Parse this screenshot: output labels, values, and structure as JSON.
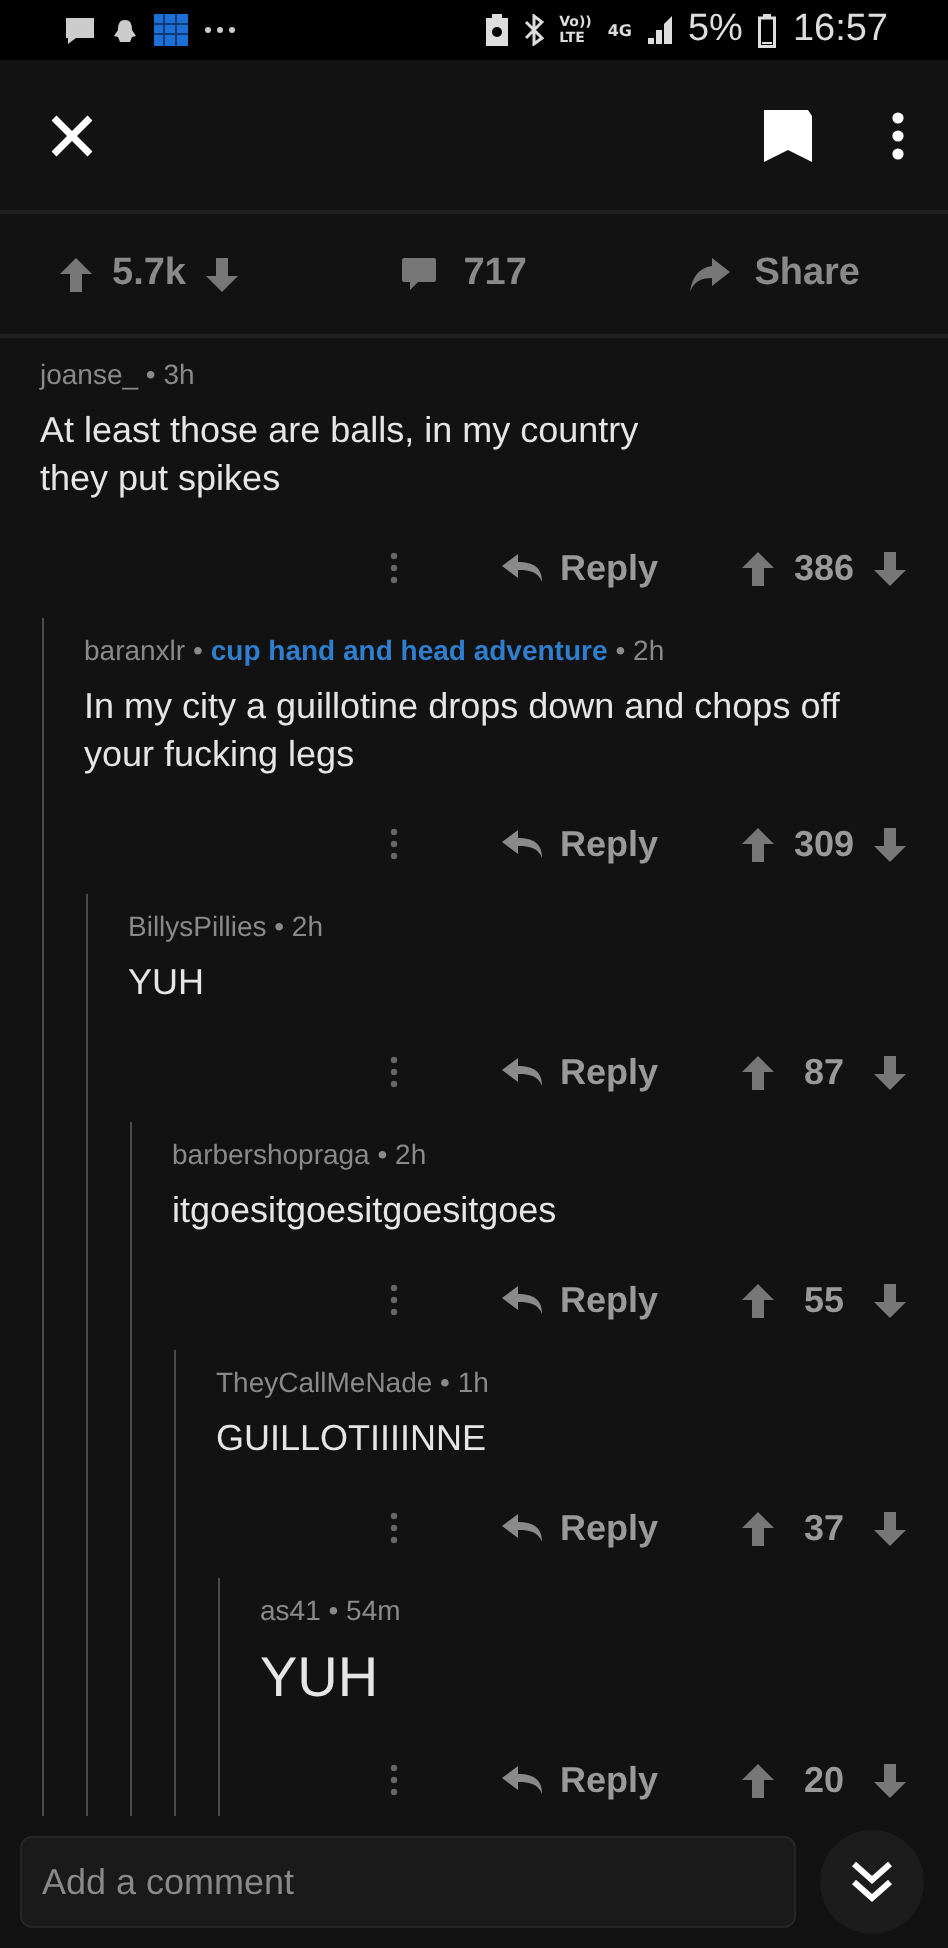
{
  "status_bar": {
    "volte": [
      "Vo))",
      "LTE"
    ],
    "network": "4G",
    "battery": "5%",
    "time": "16:57"
  },
  "post_bar": {
    "score": "5.7k",
    "comments": "717",
    "share": "Share"
  },
  "comments": [
    {
      "kind": "normal",
      "byline": [
        {
          "kind": "plain",
          "text": "joanse_ • 3h"
        }
      ],
      "body": "At least those are balls, in my country\nthey put spikes",
      "reply": "Reply",
      "score": "386",
      "children": [
        {
          "kind": "normal",
          "byline": [
            {
              "kind": "plain",
              "text": "baranxlr •"
            },
            {
              "kind": "flair",
              "text": "cup hand and head adventure"
            },
            {
              "kind": "plain",
              "text": "• 2h"
            }
          ],
          "body": "In my city a guillotine drops down and chops off your fucking legs",
          "reply": "Reply",
          "score": "309",
          "children": [
            {
              "kind": "normal",
              "byline": [
                {
                  "kind": "plain",
                  "text": "BillysPillies • 2h"
                }
              ],
              "body": "YUH",
              "reply": "Reply",
              "score": "87",
              "children": [
                {
                  "kind": "normal",
                  "byline": [
                    {
                      "kind": "plain",
                      "text": "barbershopraga • 2h"
                    }
                  ],
                  "body": "itgoesitgoesitgoesitgoes",
                  "reply": "Reply",
                  "score": "55",
                  "children": [
                    {
                      "kind": "normal",
                      "byline": [
                        {
                          "kind": "plain",
                          "text": "TheyCallMeNade • 1h"
                        }
                      ],
                      "body": "GUILLOTIIIINNE",
                      "reply": "Reply",
                      "score": "37",
                      "children": [
                        {
                          "kind": "big",
                          "byline": [
                            {
                              "kind": "plain",
                              "text": "as41 • 54m"
                            }
                          ],
                          "body": "YUH",
                          "reply": "Reply",
                          "score": "20"
                        }
                      ]
                    }
                  ]
                }
              ]
            }
          ]
        }
      ]
    }
  ],
  "composer": {
    "placeholder": "Add a comment"
  }
}
